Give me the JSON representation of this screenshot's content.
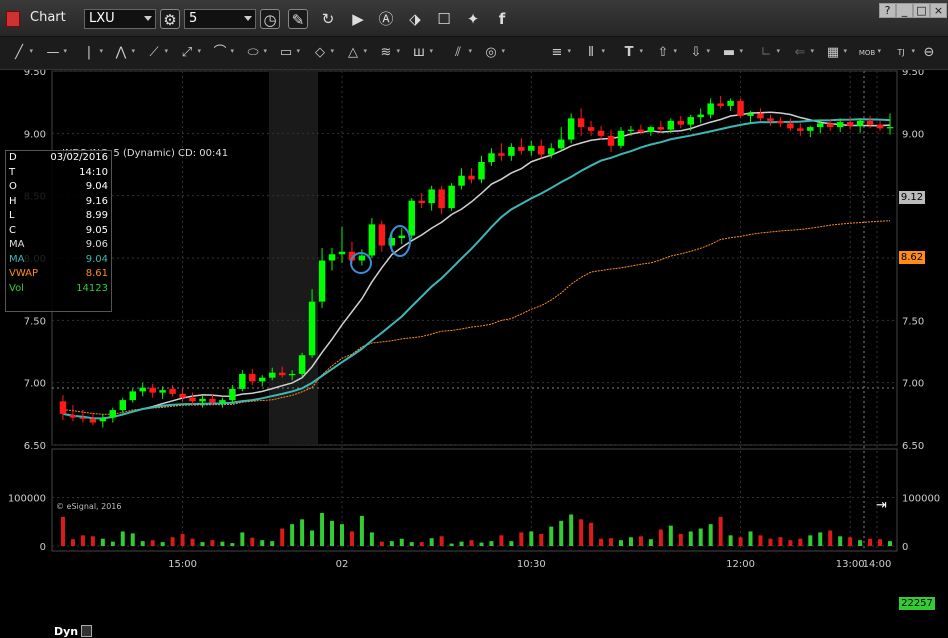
{
  "window": {
    "title": "Chart",
    "controls": [
      "?",
      "_",
      "□",
      "×"
    ]
  },
  "toolbar": {
    "symbol": "LXU",
    "interval": "5",
    "icons": [
      "time-template-icon",
      "clock-icon",
      "pencil-icon",
      "refresh-icon",
      "play-icon",
      "alert-icon",
      "link-icon",
      "chat-icon",
      "twitter-icon",
      "facebook-icon"
    ]
  },
  "drawing_tools": [
    "line",
    "horizontal-line",
    "vertical-line",
    "zigzag",
    "fan",
    "fibonacci",
    "arc",
    "ellipse",
    "rectangle",
    "eraser",
    "triangle",
    "channel",
    "pitchfork",
    "parallel",
    "circle",
    "text-lines",
    "bars",
    "text",
    "arrow-up",
    "arrow-down",
    "highlight",
    "lock",
    "cursor-back",
    "grid",
    "mob",
    "tj"
  ],
  "chart_header": {
    "text": "INDS INC, 5 (Dynamic) CD: 00:41"
  },
  "data_window": {
    "rows": [
      {
        "label": "D",
        "value": "03/02/2016",
        "color": "#ffffff"
      },
      {
        "label": "T",
        "value": "14:10",
        "color": "#ffffff"
      },
      {
        "label": "O",
        "value": "9.04",
        "color": "#ffffff"
      },
      {
        "label": "H",
        "value": "9.16",
        "color": "#ffffff"
      },
      {
        "label": "L",
        "value": "8.99",
        "color": "#ffffff"
      },
      {
        "label": "C",
        "value": "9.05",
        "color": "#ffffff"
      },
      {
        "label": "MA",
        "value": "9.06",
        "color": "#dddddd"
      },
      {
        "label": "MA",
        "value": "9.04",
        "color": "#3fb6b6"
      },
      {
        "label": "VWAP",
        "value": "8.61",
        "color": "#ff8c1a"
      },
      {
        "label": "Vol",
        "value": "14123",
        "color": "#33cc33"
      }
    ]
  },
  "copyright": "© eSignal, 2016",
  "price_tags": {
    "last": "9.12",
    "vwap": "8.62",
    "volume": "22257"
  },
  "bottom": {
    "dyn": "Dyn"
  },
  "chart_data": {
    "type": "candlestick",
    "price_axis": {
      "ticks": [
        "9.50",
        "9.00",
        "8.50",
        "8.00",
        "7.50",
        "7.00",
        "6.50"
      ],
      "ylim": [
        6.5,
        9.5
      ]
    },
    "volume_axis": {
      "ticks": [
        "100000",
        "0"
      ],
      "ylim": [
        0,
        200000
      ]
    },
    "time_ticks": [
      "15:00",
      "02",
      "10:30",
      "12:00",
      "13:00",
      "14:00"
    ],
    "up_color": "#00ff00",
    "down_color": "#ff1a1a",
    "ma_fast_color": "#d0d0d0",
    "ma_slow_color": "#3fb6b6",
    "vwap_color": "#ff8c1a",
    "candles": [
      {
        "o": 6.85,
        "h": 6.9,
        "l": 6.7,
        "c": 6.75
      },
      {
        "o": 6.74,
        "h": 6.82,
        "l": 6.69,
        "c": 6.72
      },
      {
        "o": 6.72,
        "h": 6.78,
        "l": 6.68,
        "c": 6.71
      },
      {
        "o": 6.71,
        "h": 6.75,
        "l": 6.66,
        "c": 6.68
      },
      {
        "o": 6.69,
        "h": 6.75,
        "l": 6.64,
        "c": 6.71
      },
      {
        "o": 6.72,
        "h": 6.8,
        "l": 6.68,
        "c": 6.78
      },
      {
        "o": 6.78,
        "h": 6.88,
        "l": 6.75,
        "c": 6.86
      },
      {
        "o": 6.86,
        "h": 6.95,
        "l": 6.84,
        "c": 6.93
      },
      {
        "o": 6.93,
        "h": 7.0,
        "l": 6.89,
        "c": 6.96
      },
      {
        "o": 6.96,
        "h": 6.99,
        "l": 6.88,
        "c": 6.92
      },
      {
        "o": 6.92,
        "h": 6.97,
        "l": 6.87,
        "c": 6.94
      },
      {
        "o": 6.95,
        "h": 6.98,
        "l": 6.89,
        "c": 6.91
      },
      {
        "o": 6.91,
        "h": 6.96,
        "l": 6.85,
        "c": 6.88
      },
      {
        "o": 6.88,
        "h": 6.92,
        "l": 6.82,
        "c": 6.85
      },
      {
        "o": 6.85,
        "h": 6.9,
        "l": 6.8,
        "c": 6.87
      },
      {
        "o": 6.87,
        "h": 6.91,
        "l": 6.82,
        "c": 6.84
      },
      {
        "o": 6.84,
        "h": 6.88,
        "l": 6.8,
        "c": 6.86
      },
      {
        "o": 6.86,
        "h": 6.98,
        "l": 6.83,
        "c": 6.95
      },
      {
        "o": 6.95,
        "h": 7.1,
        "l": 6.93,
        "c": 7.07
      },
      {
        "o": 7.07,
        "h": 7.11,
        "l": 6.98,
        "c": 7.01
      },
      {
        "o": 7.01,
        "h": 7.06,
        "l": 6.97,
        "c": 7.04
      },
      {
        "o": 7.04,
        "h": 7.12,
        "l": 7.02,
        "c": 7.08
      },
      {
        "o": 7.08,
        "h": 7.13,
        "l": 7.04,
        "c": 7.06
      },
      {
        "o": 7.06,
        "h": 7.1,
        "l": 7.02,
        "c": 7.07
      },
      {
        "o": 7.07,
        "h": 7.24,
        "l": 7.05,
        "c": 7.22
      },
      {
        "o": 7.22,
        "h": 7.75,
        "l": 7.2,
        "c": 7.65
      },
      {
        "o": 7.65,
        "h": 8.08,
        "l": 7.6,
        "c": 7.98
      },
      {
        "o": 7.98,
        "h": 8.08,
        "l": 7.9,
        "c": 8.03
      },
      {
        "o": 8.03,
        "h": 8.25,
        "l": 7.96,
        "c": 8.05
      },
      {
        "o": 8.05,
        "h": 8.13,
        "l": 7.95,
        "c": 7.98
      },
      {
        "o": 7.98,
        "h": 8.07,
        "l": 7.94,
        "c": 8.02
      },
      {
        "o": 8.02,
        "h": 8.32,
        "l": 8.0,
        "c": 8.27
      },
      {
        "o": 8.27,
        "h": 8.3,
        "l": 8.05,
        "c": 8.1
      },
      {
        "o": 8.1,
        "h": 8.2,
        "l": 8.05,
        "c": 8.16
      },
      {
        "o": 8.16,
        "h": 8.24,
        "l": 8.11,
        "c": 8.18
      },
      {
        "o": 8.18,
        "h": 8.48,
        "l": 8.15,
        "c": 8.46
      },
      {
        "o": 8.46,
        "h": 8.52,
        "l": 8.4,
        "c": 8.44
      },
      {
        "o": 8.44,
        "h": 8.58,
        "l": 8.38,
        "c": 8.55
      },
      {
        "o": 8.55,
        "h": 8.58,
        "l": 8.35,
        "c": 8.4
      },
      {
        "o": 8.4,
        "h": 8.6,
        "l": 8.38,
        "c": 8.58
      },
      {
        "o": 8.58,
        "h": 8.72,
        "l": 8.55,
        "c": 8.66
      },
      {
        "o": 8.66,
        "h": 8.72,
        "l": 8.6,
        "c": 8.63
      },
      {
        "o": 8.63,
        "h": 8.82,
        "l": 8.6,
        "c": 8.77
      },
      {
        "o": 8.77,
        "h": 8.88,
        "l": 8.74,
        "c": 8.84
      },
      {
        "o": 8.84,
        "h": 8.92,
        "l": 8.78,
        "c": 8.82
      },
      {
        "o": 8.82,
        "h": 8.92,
        "l": 8.78,
        "c": 8.89
      },
      {
        "o": 8.89,
        "h": 8.96,
        "l": 8.83,
        "c": 8.86
      },
      {
        "o": 8.86,
        "h": 8.94,
        "l": 8.82,
        "c": 8.9
      },
      {
        "o": 8.9,
        "h": 8.95,
        "l": 8.8,
        "c": 8.83
      },
      {
        "o": 8.83,
        "h": 8.92,
        "l": 8.8,
        "c": 8.88
      },
      {
        "o": 8.88,
        "h": 9.05,
        "l": 8.86,
        "c": 8.95
      },
      {
        "o": 8.95,
        "h": 9.16,
        "l": 8.92,
        "c": 9.12
      },
      {
        "o": 9.12,
        "h": 9.2,
        "l": 8.98,
        "c": 9.05
      },
      {
        "o": 9.05,
        "h": 9.1,
        "l": 8.98,
        "c": 9.02
      },
      {
        "o": 9.02,
        "h": 9.06,
        "l": 8.95,
        "c": 8.98
      },
      {
        "o": 8.98,
        "h": 9.03,
        "l": 8.85,
        "c": 8.9
      },
      {
        "o": 8.9,
        "h": 9.05,
        "l": 8.88,
        "c": 9.02
      },
      {
        "o": 9.02,
        "h": 9.06,
        "l": 8.98,
        "c": 9.03
      },
      {
        "o": 9.03,
        "h": 9.07,
        "l": 8.99,
        "c": 9.01
      },
      {
        "o": 9.01,
        "h": 9.06,
        "l": 8.98,
        "c": 9.05
      },
      {
        "o": 9.05,
        "h": 9.1,
        "l": 9.0,
        "c": 9.03
      },
      {
        "o": 9.03,
        "h": 9.12,
        "l": 9.0,
        "c": 9.1
      },
      {
        "o": 9.1,
        "h": 9.14,
        "l": 9.04,
        "c": 9.07
      },
      {
        "o": 9.07,
        "h": 9.15,
        "l": 9.02,
        "c": 9.13
      },
      {
        "o": 9.13,
        "h": 9.2,
        "l": 9.08,
        "c": 9.15
      },
      {
        "o": 9.15,
        "h": 9.28,
        "l": 9.12,
        "c": 9.24
      },
      {
        "o": 9.24,
        "h": 9.3,
        "l": 9.2,
        "c": 9.22
      },
      {
        "o": 9.22,
        "h": 9.28,
        "l": 9.18,
        "c": 9.26
      },
      {
        "o": 9.26,
        "h": 9.28,
        "l": 9.12,
        "c": 9.14
      },
      {
        "o": 9.14,
        "h": 9.18,
        "l": 9.08,
        "c": 9.16
      },
      {
        "o": 9.16,
        "h": 9.2,
        "l": 9.1,
        "c": 9.12
      },
      {
        "o": 9.12,
        "h": 9.15,
        "l": 9.06,
        "c": 9.1
      },
      {
        "o": 9.1,
        "h": 9.13,
        "l": 9.05,
        "c": 9.08
      },
      {
        "o": 9.08,
        "h": 9.12,
        "l": 9.02,
        "c": 9.04
      },
      {
        "o": 9.04,
        "h": 9.08,
        "l": 8.98,
        "c": 9.02
      },
      {
        "o": 9.02,
        "h": 9.06,
        "l": 8.97,
        "c": 9.05
      },
      {
        "o": 9.05,
        "h": 9.1,
        "l": 9.0,
        "c": 9.08
      },
      {
        "o": 9.08,
        "h": 9.11,
        "l": 9.02,
        "c": 9.05
      },
      {
        "o": 9.05,
        "h": 9.12,
        "l": 9.01,
        "c": 9.09
      },
      {
        "o": 9.09,
        "h": 9.13,
        "l": 9.03,
        "c": 9.06
      },
      {
        "o": 9.06,
        "h": 9.12,
        "l": 9.0,
        "c": 9.1
      },
      {
        "o": 9.1,
        "h": 9.14,
        "l": 9.04,
        "c": 9.07
      },
      {
        "o": 9.07,
        "h": 9.1,
        "l": 9.02,
        "c": 9.04
      },
      {
        "o": 9.04,
        "h": 9.16,
        "l": 8.99,
        "c": 9.05
      }
    ],
    "volume": [
      60000,
      14000,
      22000,
      20000,
      15000,
      9000,
      30000,
      26000,
      10000,
      12000,
      8000,
      18000,
      25000,
      15000,
      8000,
      12000,
      9000,
      6000,
      28000,
      17000,
      12000,
      10000,
      36000,
      45000,
      55000,
      32000,
      68000,
      52000,
      45000,
      30000,
      62000,
      28000,
      9000,
      10000,
      15000,
      8000,
      8000,
      16000,
      20000,
      5000,
      9000,
      12000,
      7000,
      10000,
      22000,
      10000,
      28000,
      30000,
      25000,
      40000,
      52000,
      65000,
      55000,
      48000,
      15000,
      16000,
      12000,
      18000,
      20000,
      14000,
      34000,
      42000,
      25000,
      30000,
      36000,
      45000,
      60000,
      22000,
      18000,
      30000,
      22000,
      15000,
      18000,
      12000,
      15000,
      22000,
      28000,
      32000,
      20000,
      18000,
      12000,
      15000,
      14000,
      10000,
      20000,
      22000
    ],
    "volume_last_labeled": 22257
  }
}
